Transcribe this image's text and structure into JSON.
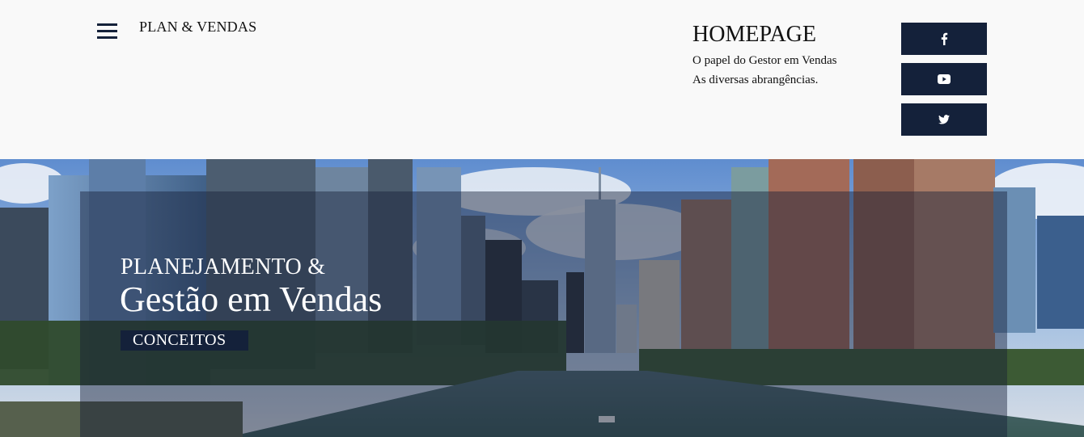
{
  "header": {
    "menu_icon": "hamburger-menu-icon",
    "brand": "PLAN & VENDAS",
    "homepage_title": "HOMEPAGE",
    "homepage_lines": [
      "O papel do Gestor em Vendas",
      "As diversas abrangências."
    ],
    "social": [
      {
        "icon": "facebook-icon",
        "label": "f"
      },
      {
        "icon": "youtube-icon"
      },
      {
        "icon": "twitter-icon"
      }
    ],
    "accent_color": "#14213a"
  },
  "hero": {
    "kicker": "PLANEJAMENTO &",
    "title": "Gestão em Vendas",
    "tag": "CONCEITOS",
    "image": "city-river-skyline-photo"
  }
}
